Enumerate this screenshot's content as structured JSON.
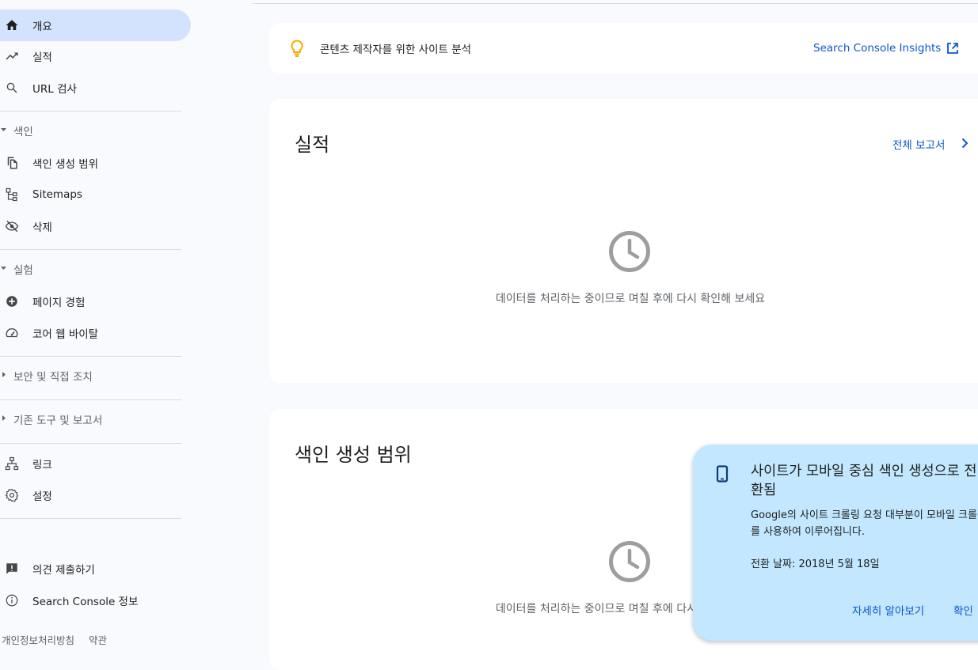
{
  "sidebar": {
    "items": [
      {
        "label": "개요"
      },
      {
        "label": "실적"
      },
      {
        "label": "URL 검사"
      }
    ],
    "index_section": {
      "label": "색인"
    },
    "index_items": [
      {
        "label": "색인 생성 범위"
      },
      {
        "label": "Sitemaps"
      },
      {
        "label": "삭제"
      }
    ],
    "experience_section": {
      "label": "실험"
    },
    "experience_items": [
      {
        "label": "페이지 경험"
      },
      {
        "label": "코어 웹 바이탈"
      }
    ],
    "security_section": {
      "label": "보안 및 직접 조치"
    },
    "legacy_section": {
      "label": "기존 도구 및 보고서"
    },
    "other_items": [
      {
        "label": "링크"
      },
      {
        "label": "설정"
      }
    ],
    "bottom_items": [
      {
        "label": "의견 제출하기"
      },
      {
        "label": "Search Console 정보"
      }
    ],
    "footer": {
      "privacy": "개인정보처리방침",
      "terms": "약관"
    }
  },
  "insights": {
    "text": "콘텐츠 제작자를 위한 사이트 분석",
    "link": "Search Console Insights"
  },
  "performance": {
    "title": "실적",
    "report_link": "전체 보고서",
    "pending": "데이터를 처리하는 중이므로 며칠 후에 다시 확인해 보세요"
  },
  "coverage": {
    "title": "색인 생성 범위",
    "pending": "데이터를 처리하는 중이므로 며칠 후에 다시 확인해 보세요"
  },
  "notice": {
    "title": "사이트가 모바일 중심 색인 생성으로 전환됨",
    "body": "Google의 사이트 크롤링 요청 대부분이 모바일 크롤러를 사용하여 이루어집니다.",
    "date": "전환 날짜: 2018년 5월 18일",
    "learn_more": "자세히 알아보기",
    "ok": "확인"
  },
  "colors": {
    "active_bg": "#d3e3fd",
    "link": "#0b57d0",
    "notice_bg": "#c2e7ff",
    "bulb": "#f9ab00"
  }
}
